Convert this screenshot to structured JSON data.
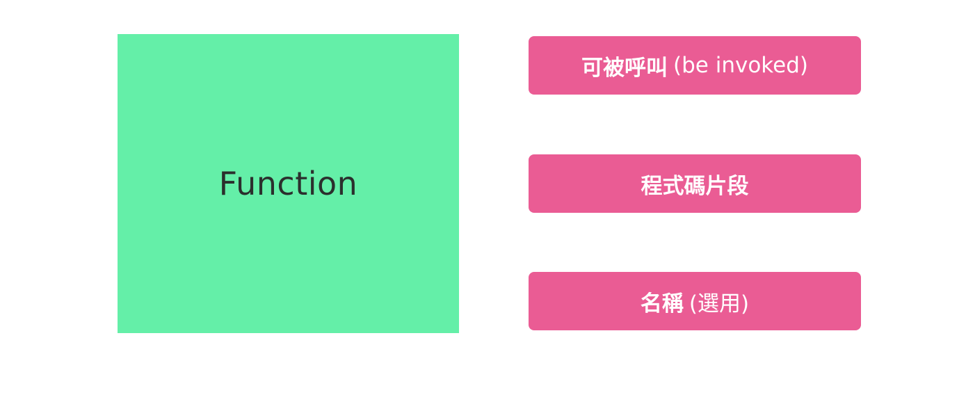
{
  "colors": {
    "background": "#ffffff",
    "function_fill": "#64efa8",
    "function_text": "#2b2f2d",
    "property_fill": "#ea5c94",
    "property_text": "#ffffff"
  },
  "function": {
    "label": "Function"
  },
  "properties": [
    {
      "strong": "可被呼叫",
      "light": "(be invoked)"
    },
    {
      "strong": "程式碼片段",
      "light": ""
    },
    {
      "strong": "名稱",
      "light": "(選用)"
    }
  ]
}
